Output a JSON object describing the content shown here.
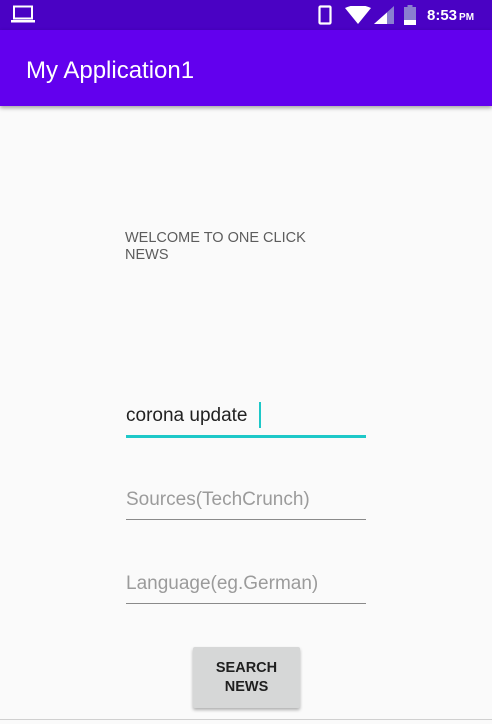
{
  "status_bar": {
    "time": "8:53",
    "ampm": "PM",
    "icons": [
      "laptop-icon",
      "phone-icon",
      "wifi-icon",
      "signal-icon",
      "battery-icon"
    ],
    "color": "#4a02c4"
  },
  "app_bar": {
    "title": "My Application1",
    "color": "#6200ee"
  },
  "main": {
    "welcome_text": "WELCOME TO ONE CLICK NEWS",
    "query_value": "corona update",
    "sources_placeholder": "Sources(TechCrunch)",
    "language_placeholder": "Language(eg.German)",
    "search_button_label": "SEARCH NEWS",
    "accent_color": "#1ec8c8"
  }
}
